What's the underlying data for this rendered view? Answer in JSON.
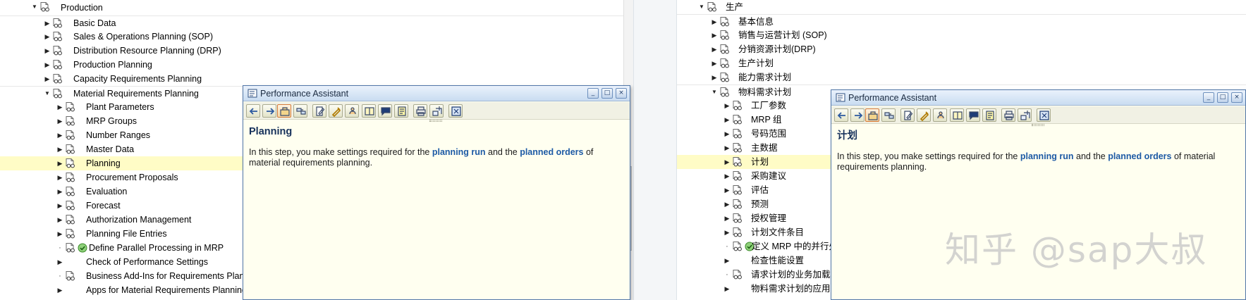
{
  "colors": {
    "selected_row": "#fffcc6",
    "link": "#1d5aa5",
    "help_title": "#16315b",
    "help_bg": "#fffff0"
  },
  "left": {
    "root": "Production",
    "items": [
      {
        "label": "Basic Data"
      },
      {
        "label": "Sales & Operations Planning (SOP)"
      },
      {
        "label": "Distribution Resource Planning (DRP)"
      },
      {
        "label": "Production Planning"
      },
      {
        "label": "Capacity Requirements Planning"
      },
      {
        "label": "Material Requirements Planning"
      },
      {
        "label": "Plant Parameters"
      },
      {
        "label": "MRP Groups"
      },
      {
        "label": "Number Ranges"
      },
      {
        "label": "Master Data"
      },
      {
        "label": "Planning"
      },
      {
        "label": "Procurement Proposals"
      },
      {
        "label": "Evaluation"
      },
      {
        "label": "Forecast"
      },
      {
        "label": "Authorization Management"
      },
      {
        "label": "Planning File Entries"
      },
      {
        "label": "Define Parallel Processing in MRP"
      },
      {
        "label": "Check of Performance Settings"
      },
      {
        "label": "Business Add-Ins for Requirements Planning"
      },
      {
        "label": "Apps for Material Requirements Planning"
      }
    ],
    "help": {
      "window_title": "Performance Assistant",
      "heading": "Planning",
      "text_1": "In this step, you make settings required for the ",
      "link_1": "planning run",
      "text_2": " and the ",
      "link_2": "planned orders",
      "text_3": " of material requirements planning."
    }
  },
  "right": {
    "root": "生产",
    "items": [
      {
        "label": "基本信息"
      },
      {
        "label": "销售与运营计划 (SOP)"
      },
      {
        "label": "分销资源计划(DRP)"
      },
      {
        "label": "生产计划"
      },
      {
        "label": "能力需求计划"
      },
      {
        "label": "物料需求计划"
      },
      {
        "label": "工厂参数"
      },
      {
        "label": "MRP 组"
      },
      {
        "label": "号码范围"
      },
      {
        "label": "主数据"
      },
      {
        "label": "计划"
      },
      {
        "label": "采购建议"
      },
      {
        "label": "评估"
      },
      {
        "label": "预测"
      },
      {
        "label": "授权管理"
      },
      {
        "label": "计划文件条目"
      },
      {
        "label": "定义 MRP 中的并行处理"
      },
      {
        "label": "检查性能设置"
      },
      {
        "label": "请求计划的业务加载项"
      },
      {
        "label": "物料需求计划的应用"
      }
    ],
    "help": {
      "window_title": "Performance Assistant",
      "heading": "计划",
      "text_1": "In this step, you make settings required for the ",
      "link_1": "planning run",
      "text_2": " and the ",
      "link_2": "planned orders",
      "text_3": " of material requirements planning."
    }
  },
  "window_buttons": {
    "minimize": "_",
    "maximize": "□",
    "close": "×"
  },
  "toolbar_icons": [
    "back-icon",
    "forward-icon",
    "open-topic-icon",
    "link-icon",
    "edit-icon",
    "highlight-icon",
    "technical-info-icon",
    "book-icon",
    "comment-icon",
    "note-icon",
    "print-icon",
    "export-icon",
    "close-box-icon"
  ],
  "watermark": "知乎 @sap大叔"
}
